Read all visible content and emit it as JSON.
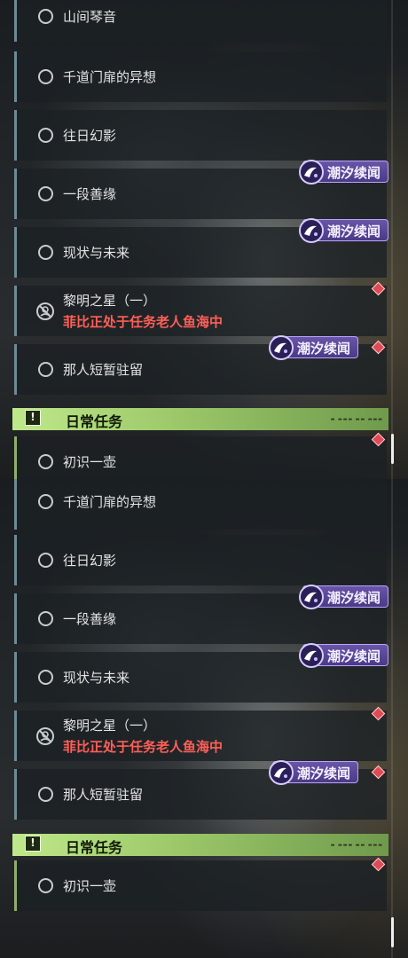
{
  "quest_panel_top": {
    "items": [
      {
        "label": "山间琴音"
      },
      {
        "label": "千道门扉的异想"
      },
      {
        "label": "往日幻影"
      },
      {
        "label": "一段善缘"
      },
      {
        "label": "现状与未来"
      },
      {
        "label": "黎明之星（一）",
        "status": "菲比正处于任务老人鱼海中"
      },
      {
        "label": "那人短暂驻留"
      }
    ],
    "section": {
      "title": "日常任务",
      "icon": "!"
    },
    "daily_items": [
      {
        "label": "初识一壶"
      }
    ],
    "badges": [
      {
        "label": "潮汐续闻"
      },
      {
        "label": "潮汐续闻"
      },
      {
        "label": "潮汐续闻"
      }
    ]
  },
  "quest_panel_bottom": {
    "items": [
      {
        "label": "千道门扉的异想"
      },
      {
        "label": "往日幻影"
      },
      {
        "label": "一段善缘"
      },
      {
        "label": "现状与未来"
      },
      {
        "label": "黎明之星（一）",
        "status": "菲比正处于任务老人鱼海中"
      },
      {
        "label": "那人短暂驻留"
      }
    ],
    "section": {
      "title": "日常任务",
      "icon": "!"
    },
    "daily_items": [
      {
        "label": "初识一壶"
      }
    ],
    "badges": [
      {
        "label": "潮汐续闻"
      },
      {
        "label": "潮汐续闻"
      },
      {
        "label": "潮汐续闻"
      }
    ]
  },
  "colors": {
    "accent_section": "#a8d47a",
    "badge_purple": "#5a47a0",
    "status_red": "#ff5f57",
    "marker_red": "#e04a55"
  },
  "icons": [
    "radio-ring-icon",
    "banned-icon",
    "tide-swirl-icon",
    "alert-icon",
    "red-diamond-marker-icon"
  ]
}
